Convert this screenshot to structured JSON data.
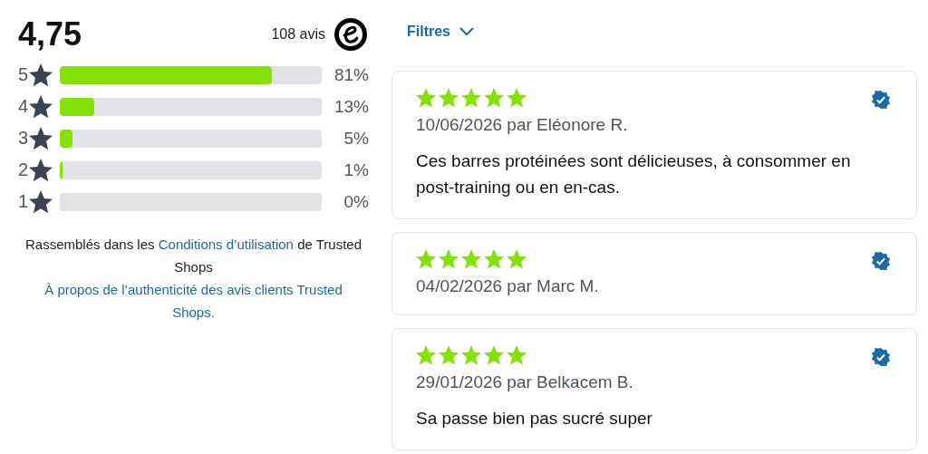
{
  "summary": {
    "score": "4,75",
    "count": "108 avis"
  },
  "distribution": [
    {
      "label": "5",
      "level": 0.81,
      "percent": "81%"
    },
    {
      "label": "4",
      "level": 0.13,
      "percent": "13%"
    },
    {
      "label": "3",
      "level": 0.05,
      "percent": "5%"
    },
    {
      "label": "2",
      "level": 0.01,
      "percent": "1%"
    },
    {
      "label": "1",
      "level": 0,
      "percent": "0%"
    }
  ],
  "notice": {
    "before": "Rassemblés dans les ",
    "link": "Conditions d’utilisation",
    "after": " de Trusted Shops"
  },
  "authenticity_link": "À propos de l’authenticité des avis clients Trusted Shops.",
  "filter": {
    "label": "Filtres",
    "expanded": false
  },
  "reviews": [
    {
      "stars": 5,
      "byline": "10/06/2026 par Eléonore R.",
      "text": "Ces barres protéinées sont délicieuses, à consommer en post-training ou en en-cas.",
      "verified": true
    },
    {
      "stars": 5,
      "byline": "04/02/2026 par Marc M.",
      "verified": true
    },
    {
      "stars": 5,
      "byline": "29/01/2026 par Belkacem B.",
      "text": "Sa passe bien pas sucré super",
      "verified": true
    }
  ]
}
